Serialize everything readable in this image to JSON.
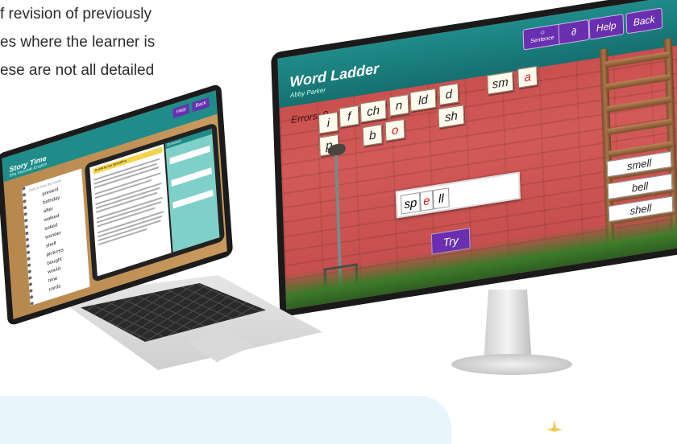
{
  "intro_lines": [
    "f revision of previously",
    "es where the learner is",
    "ese are not all detailed"
  ],
  "monitor": {
    "app_title": "Word Ladder",
    "app_subtitle": "Abby Parker",
    "nav": {
      "sentence_label": "Sentence",
      "audio_label": "¸",
      "help_label": "Help",
      "back_label": "Back"
    },
    "errors_label": "Errors: 0",
    "tiles_row1": [
      "i",
      "f",
      "ch",
      "n",
      "ld",
      "d",
      "sm",
      "a"
    ],
    "tiles_row2": [
      "p",
      "b",
      "o",
      "sh"
    ],
    "answer": {
      "part1": "sp",
      "part2": "e",
      "part3": "ll"
    },
    "try_label": "Try",
    "ladder_words": [
      "smell",
      "bell",
      "shell"
    ]
  },
  "laptop": {
    "app_title": "Story Time",
    "app_subtitle": "Ella Marshall English",
    "help_label": "Help",
    "back_label": "Back",
    "notebook_heading": "Click to hear the words",
    "words": [
      "present",
      "birthday",
      "after",
      "walked",
      "asked",
      "wonder",
      "shelf",
      "pictures",
      "bought",
      "would",
      "time",
      "cards"
    ],
    "story_heading": "A visit to my Grandma",
    "questions_heading": "Questions"
  }
}
